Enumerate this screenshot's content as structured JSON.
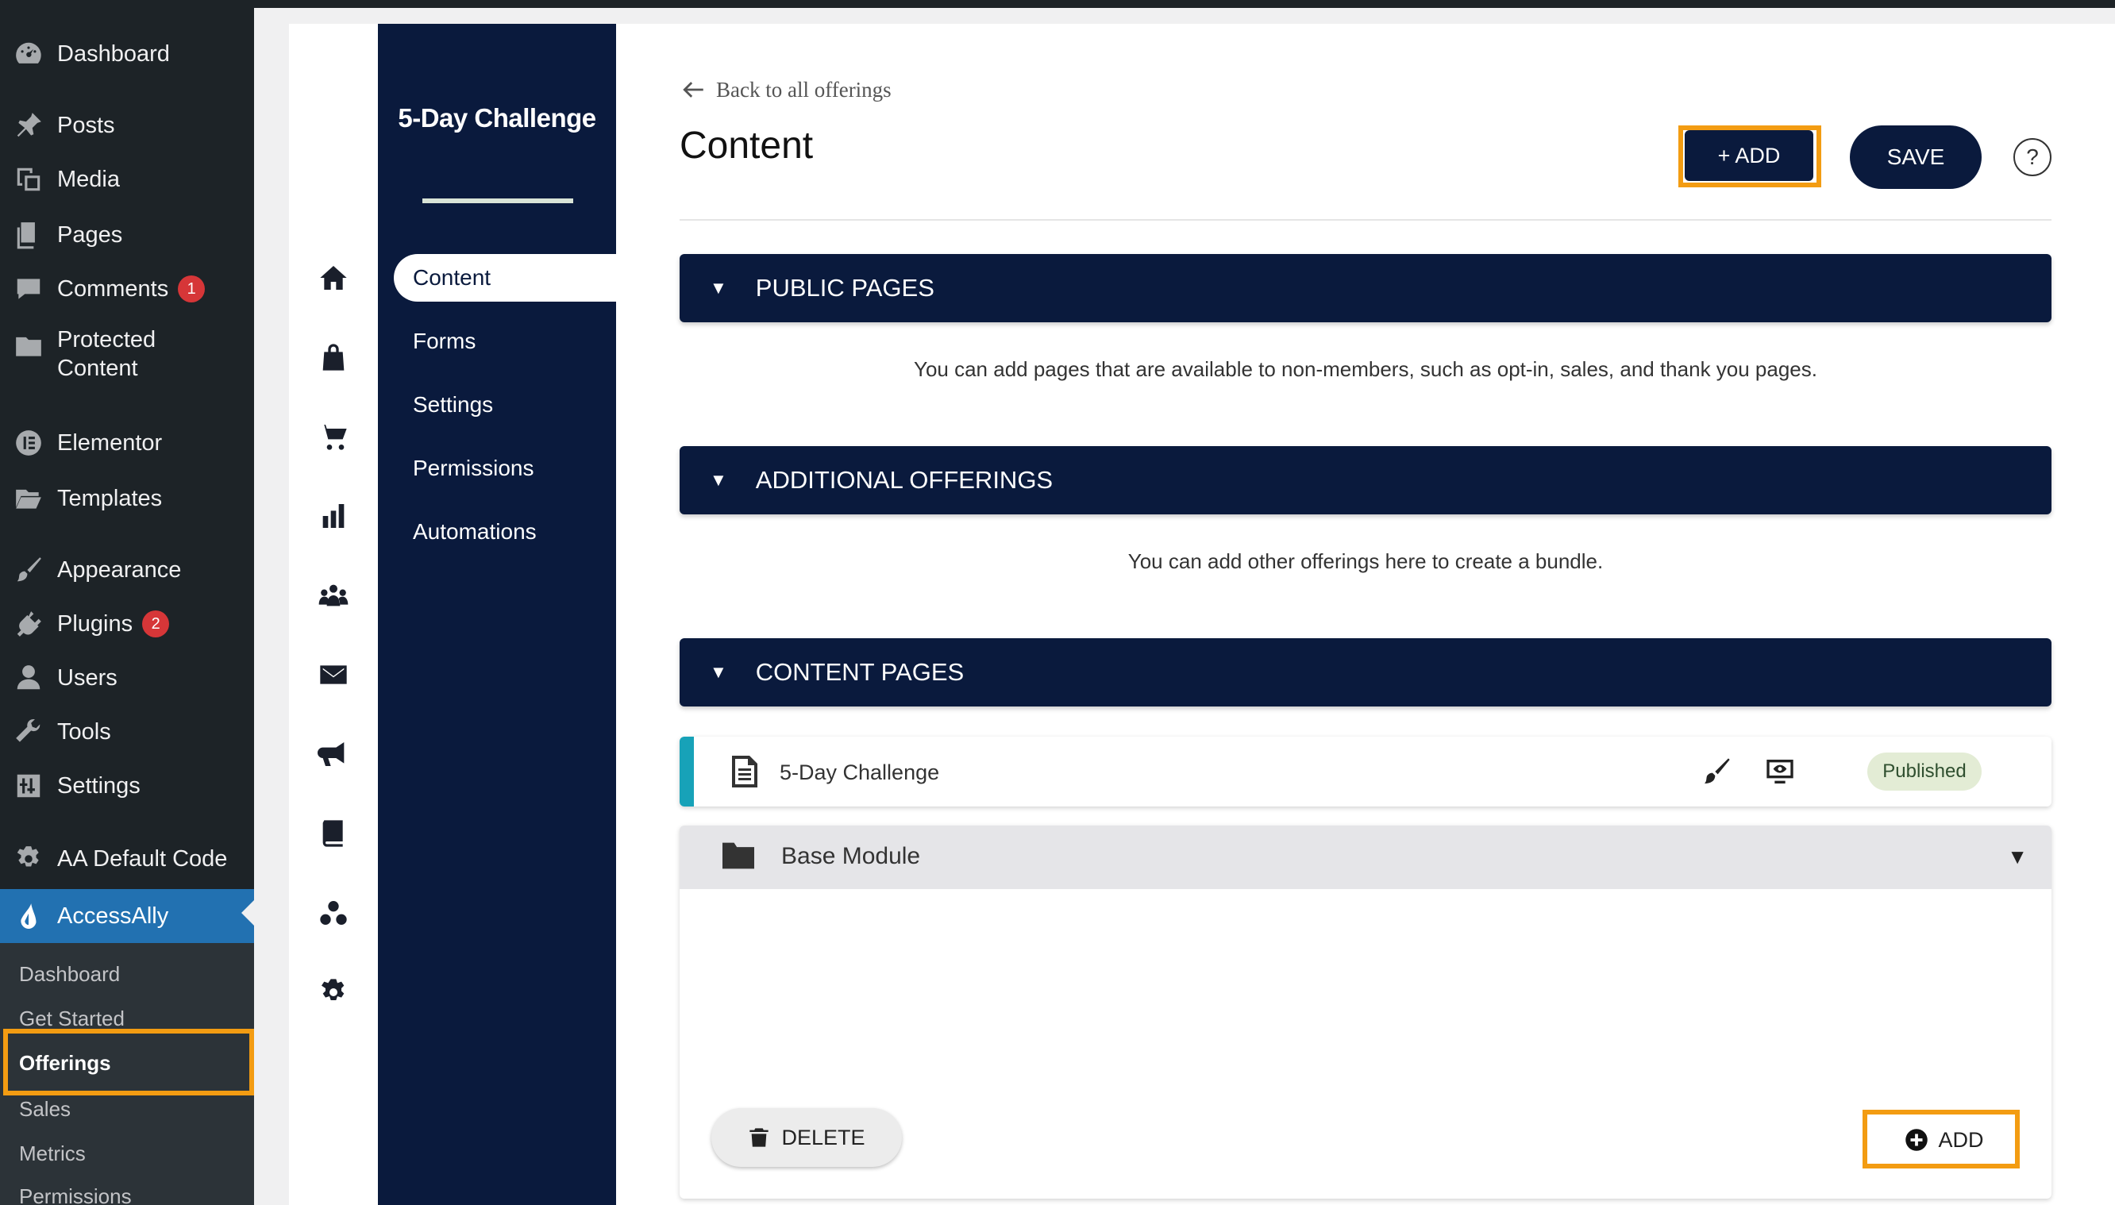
{
  "wp_menu": {
    "items": [
      {
        "label": "Dashboard",
        "icon": "dashboard-icon"
      },
      {
        "label": "Posts",
        "icon": "pin-icon"
      },
      {
        "label": "Media",
        "icon": "media-icon"
      },
      {
        "label": "Pages",
        "icon": "pages-icon"
      },
      {
        "label": "Comments",
        "icon": "comment-icon",
        "badge": "1"
      },
      {
        "label_line1": "Protected",
        "label_line2": "Content",
        "icon": "folder-icon"
      },
      {
        "label": "Elementor",
        "icon": "elementor-icon"
      },
      {
        "label": "Templates",
        "icon": "folder-open-icon"
      },
      {
        "label": "Appearance",
        "icon": "brush-icon"
      },
      {
        "label": "Plugins",
        "icon": "plug-icon",
        "badge": "2"
      },
      {
        "label": "Users",
        "icon": "user-icon"
      },
      {
        "label": "Tools",
        "icon": "wrench-icon"
      },
      {
        "label": "Settings",
        "icon": "settings-sliders-icon"
      },
      {
        "label": "AA Default Code",
        "icon": "gear-icon"
      },
      {
        "label": "AccessAlly",
        "icon": "accessally-icon"
      }
    ],
    "submenu": [
      "Dashboard",
      "Get Started",
      "Offerings",
      "Sales",
      "Metrics",
      "Permissions"
    ],
    "highlight_color": "#f39c12",
    "active_color": "#2271b1"
  },
  "offering": {
    "title": "5-Day Challenge",
    "nav": [
      "Content",
      "Forms",
      "Settings",
      "Permissions",
      "Automations"
    ]
  },
  "main": {
    "back_label": "Back to all offerings",
    "title": "Content",
    "add_label": "+ ADD",
    "save_label": "SAVE",
    "help_label": "?",
    "sections": [
      {
        "title": "PUBLIC PAGES",
        "description": "You can add pages that are available to non-members, such as opt-in, sales, and thank you pages."
      },
      {
        "title": "ADDITIONAL OFFERINGS",
        "description": "You can add other offerings here to create a bundle."
      },
      {
        "title": "CONTENT PAGES"
      }
    ],
    "page_row": {
      "name": "5-Day Challenge",
      "status": "Published"
    },
    "module": {
      "name": "Base Module",
      "delete_label": "DELETE",
      "add_label": "ADD"
    },
    "brand_color": "#0a1a3d"
  }
}
